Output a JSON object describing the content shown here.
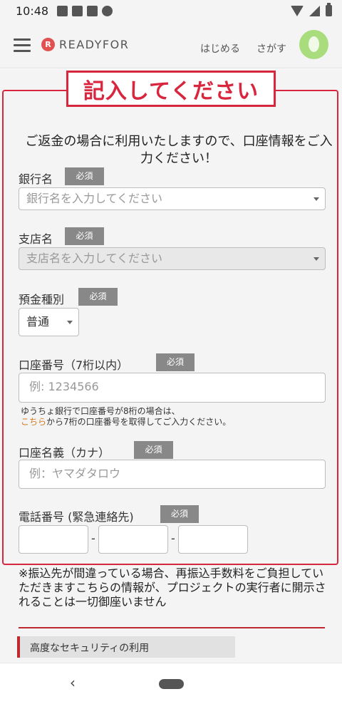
{
  "status_bar": {
    "time": "10:48"
  },
  "header": {
    "logo_mark": "R",
    "logo_text": "READYFOR",
    "nav": [
      "はじめる",
      "さがす"
    ]
  },
  "annotation": "記入してください",
  "intro": "ご返金の場合に利用いたしますので、口座情報をご入力ください！",
  "required_badge": "必須",
  "fields": {
    "bank": {
      "label": "銀行名",
      "placeholder": "銀行名を入力してください"
    },
    "branch": {
      "label": "支店名",
      "placeholder": "支店名を入力してください"
    },
    "account_type": {
      "label": "預金種別",
      "value": "普通"
    },
    "account_number": {
      "label": "口座番号（7桁以内）",
      "placeholder": "例: 1234566",
      "note_line1": "ゆうちょ銀行で口座番号が8桁の場合は、",
      "note_link": "こちら",
      "note_line2": "から7桁の口座番号を取得してご入力ください。"
    },
    "account_name": {
      "label": "口座名義（カナ）",
      "placeholder": "例：ヤマダタロウ"
    },
    "phone": {
      "label": "電話番号 (緊急連絡先)",
      "separator": "-"
    }
  },
  "bottom_note": "※振込先が間違っている場合、再振込手数料をご負担していただきますこちらの情報が、プロジェクトの実行者に開示されることは一切御座いません",
  "security_label": "高度なセキュリティの利用",
  "colors": {
    "accent_red": "#d9263f",
    "badge_gray": "#888888",
    "brand_green": "#a9dc7c"
  }
}
